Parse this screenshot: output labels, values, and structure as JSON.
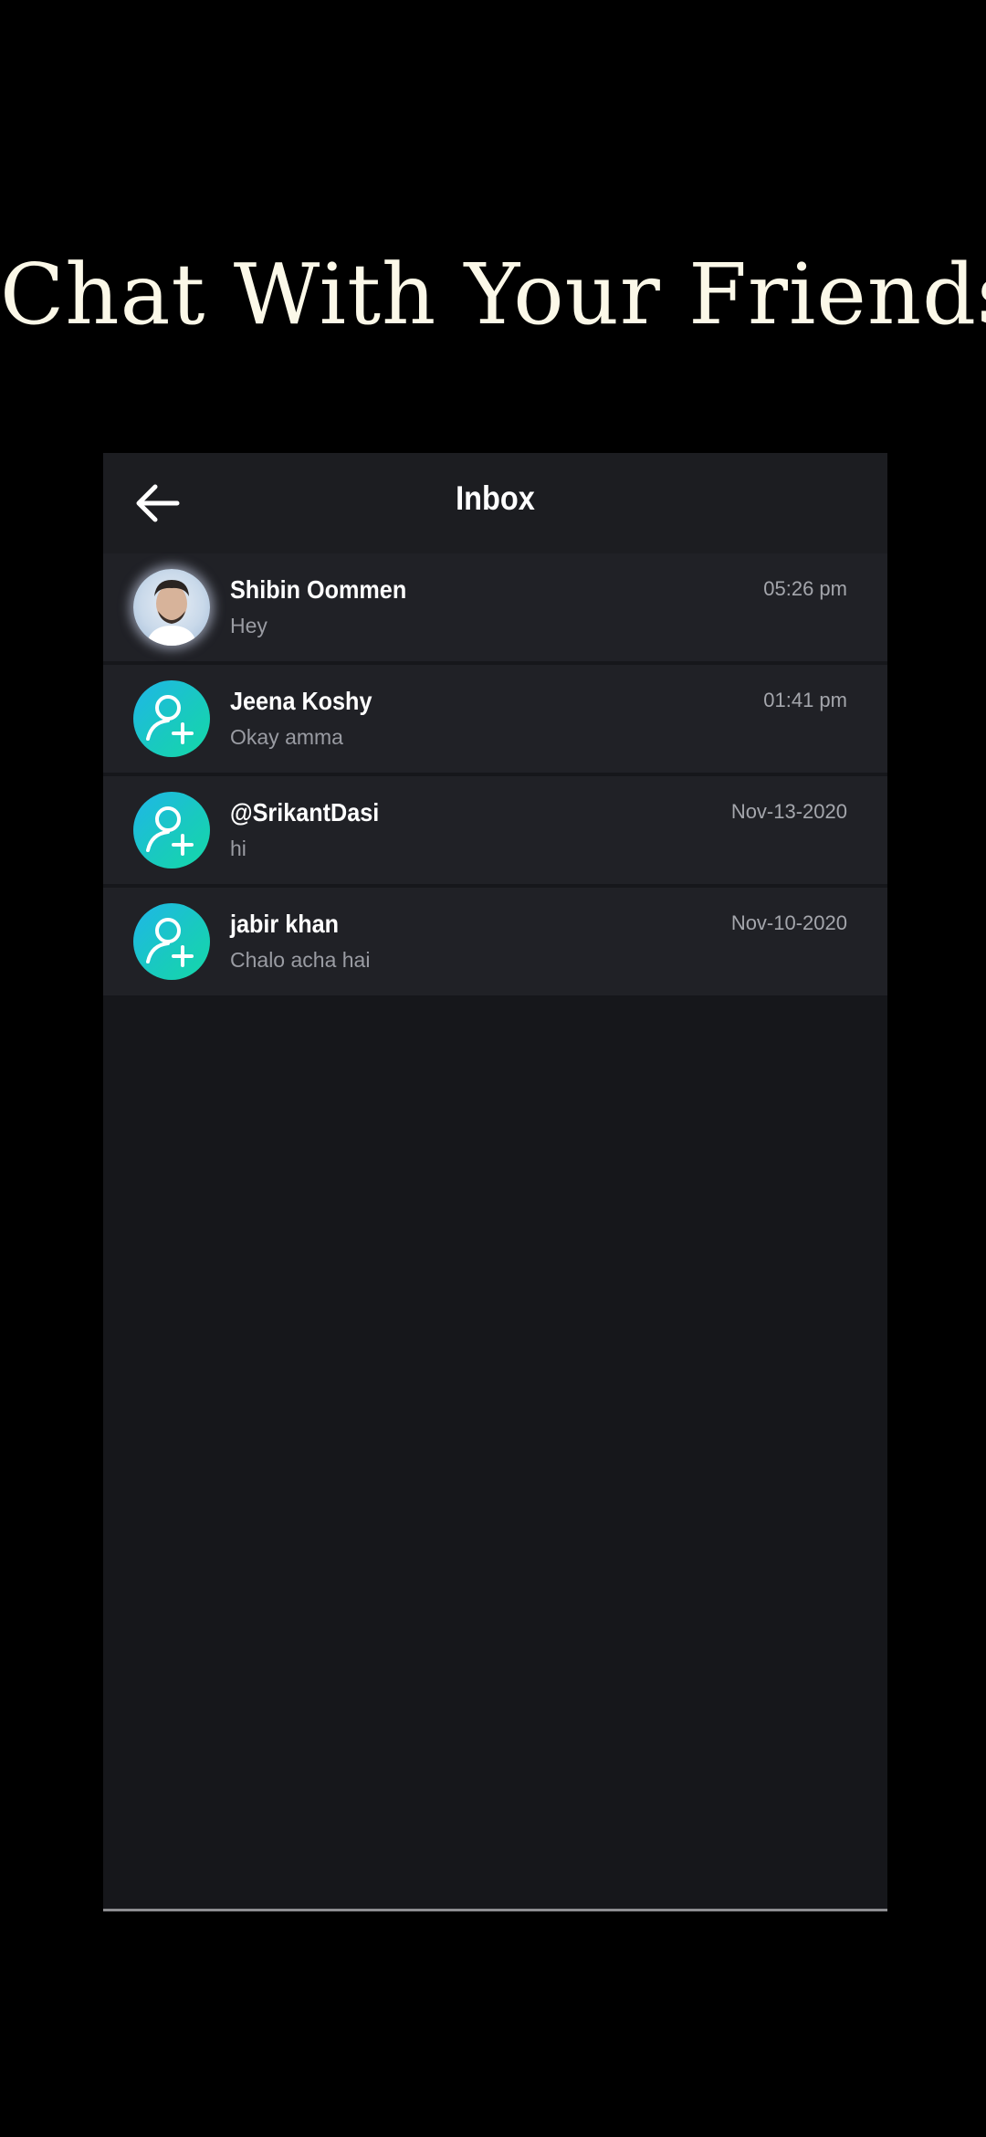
{
  "promo": {
    "title": "Chat With Your Friends"
  },
  "header": {
    "title": "Inbox",
    "back_icon": "arrow-left-icon"
  },
  "chats": [
    {
      "name": "Shibin Oommen",
      "preview": "Hey",
      "time": "05:26 pm",
      "avatar": "profile-photo"
    },
    {
      "name": "Jeena Koshy",
      "preview": "Okay amma",
      "time": "01:41 pm",
      "avatar": "add-user-icon"
    },
    {
      "name": "@SrikantDasi",
      "preview": "hi",
      "time": "Nov-13-2020",
      "avatar": "add-user-icon"
    },
    {
      "name": "jabir khan",
      "preview": "Chalo acha hai",
      "time": "Nov-10-2020",
      "avatar": "add-user-icon"
    }
  ],
  "colors": {
    "background": "#000000",
    "panel": "#16171b",
    "row": "#202126",
    "header": "#1c1d21",
    "avatar_gradient_start": "#1fb6e8",
    "avatar_gradient_end": "#14d8a8",
    "title_text": "#fbf8e8"
  }
}
